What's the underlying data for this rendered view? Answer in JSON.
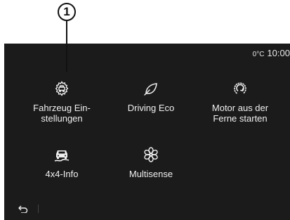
{
  "callout": {
    "number": "1"
  },
  "status": {
    "temperature": "0°C",
    "time": "10:00"
  },
  "tiles": [
    {
      "label": "Fahrzeug Ein-\nstellungen",
      "icon": "vehicle-settings-gear-icon"
    },
    {
      "label": "Driving Eco",
      "icon": "leaf-icon"
    },
    {
      "label": "Motor aus der\nFerne starten",
      "icon": "remote-engine-start-icon"
    },
    {
      "label": "4x4-Info",
      "icon": "car-terrain-icon"
    },
    {
      "label": "Multisense",
      "icon": "multisense-flower-icon"
    }
  ],
  "navigation": {
    "back_icon": "back-arrow-icon"
  },
  "colors": {
    "screen_background": "#1b1b1b",
    "text": "#f0f0f0"
  }
}
